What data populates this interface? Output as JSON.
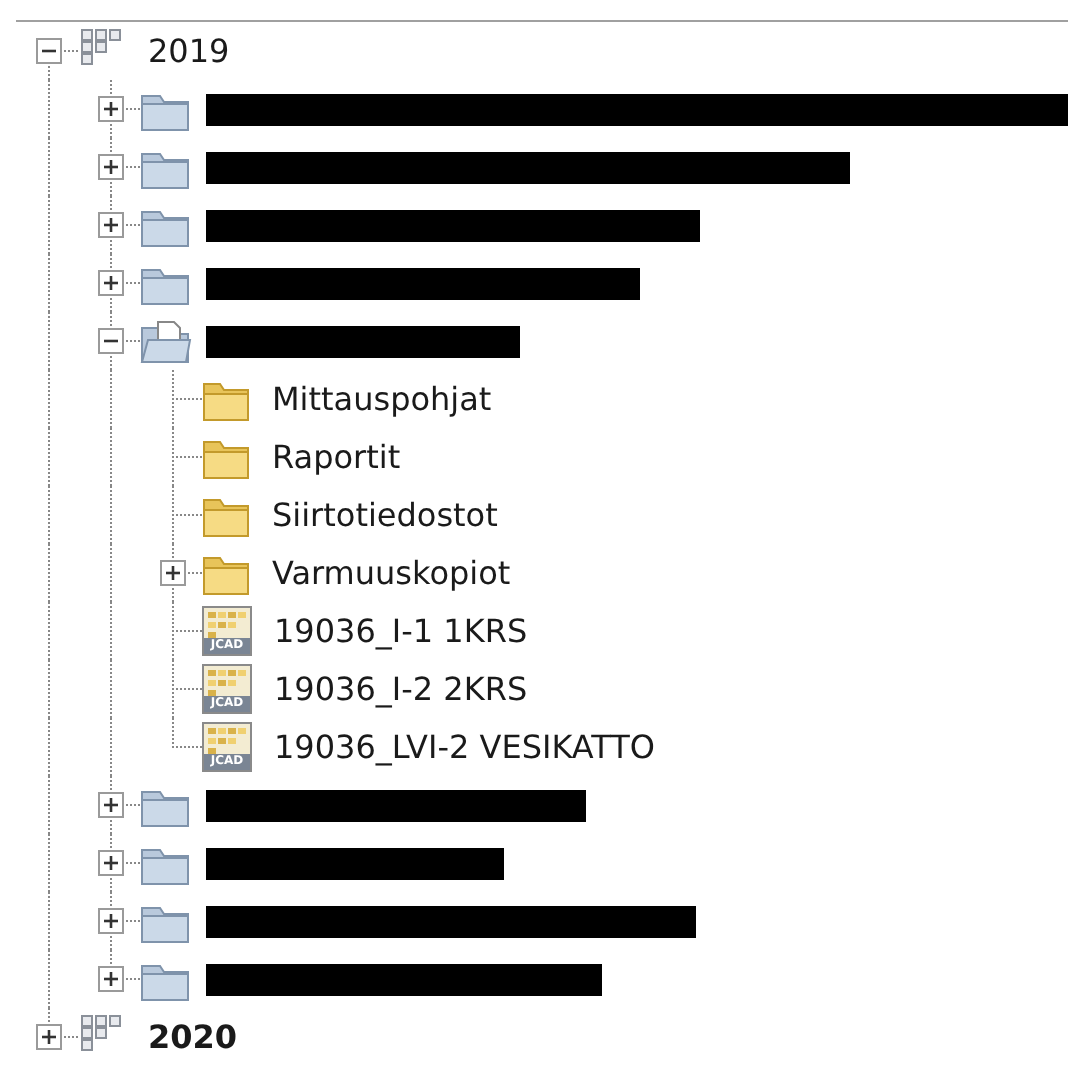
{
  "tree": [
    {
      "kind": "year",
      "label": "2019",
      "expanded": true,
      "children": [
        {
          "kind": "folder",
          "redacted": true,
          "expanded": false
        },
        {
          "kind": "folder",
          "redacted": true,
          "expanded": false
        },
        {
          "kind": "folder",
          "redacted": true,
          "expanded": false
        },
        {
          "kind": "folder",
          "redacted": true,
          "expanded": false
        },
        {
          "kind": "open-folder",
          "redacted": true,
          "expanded": true,
          "children": [
            {
              "kind": "yellow-folder",
              "label": "Mittauspohjat"
            },
            {
              "kind": "yellow-folder",
              "label": "Raportit"
            },
            {
              "kind": "yellow-folder",
              "label": "Siirtotiedostot"
            },
            {
              "kind": "yellow-folder",
              "label": "Varmuuskopiot",
              "expanded": false
            },
            {
              "kind": "jcad-file",
              "label": "19036_I-1 1KRS",
              "badge": "JCAD"
            },
            {
              "kind": "jcad-file",
              "label": "19036_I-2 2KRS",
              "badge": "JCAD"
            },
            {
              "kind": "jcad-file",
              "label": "19036_LVI-2 VESIKATTO",
              "badge": "JCAD"
            }
          ]
        },
        {
          "kind": "folder",
          "redacted": true,
          "expanded": false
        },
        {
          "kind": "folder",
          "redacted": true,
          "expanded": false
        },
        {
          "kind": "folder",
          "redacted": true,
          "expanded": false
        },
        {
          "kind": "folder",
          "redacted": true,
          "expanded": false
        }
      ]
    },
    {
      "kind": "year",
      "label": "2020",
      "expanded": false,
      "bold": true
    }
  ]
}
